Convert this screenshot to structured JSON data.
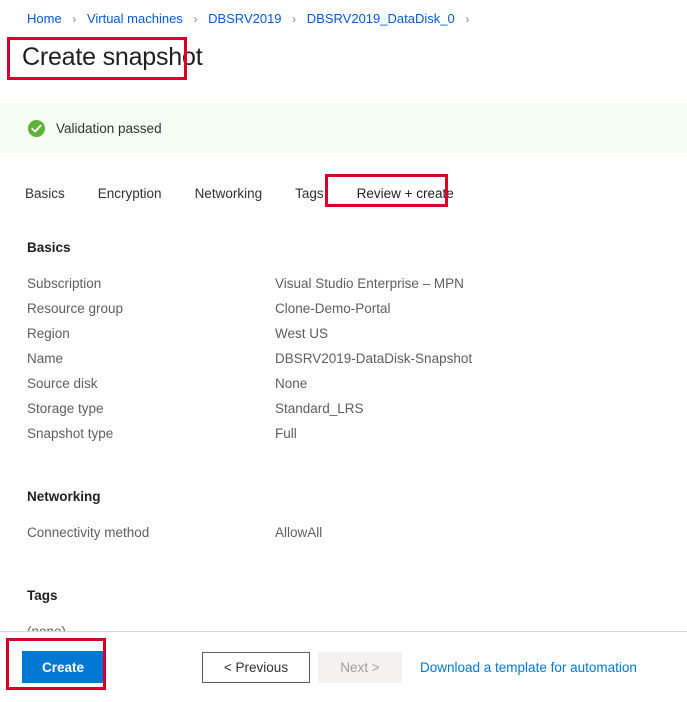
{
  "breadcrumb": {
    "separator": "›",
    "items": [
      {
        "label": "Home"
      },
      {
        "label": "Virtual machines"
      },
      {
        "label": "DBSRV2019"
      },
      {
        "label": "DBSRV2019_DataDisk_0"
      }
    ]
  },
  "header": {
    "title": "Create snapshot"
  },
  "validation": {
    "text": "Validation passed",
    "icon": "check-circle-icon",
    "background_color": "#f6fdf2",
    "icon_color": "#5cb335"
  },
  "tabs": [
    {
      "label": "Basics",
      "active": false
    },
    {
      "label": "Encryption",
      "active": false
    },
    {
      "label": "Networking",
      "active": false
    },
    {
      "label": "Tags",
      "active": false
    },
    {
      "label": "Review + create",
      "active": true
    }
  ],
  "sections": {
    "basics": {
      "title": "Basics",
      "rows": [
        {
          "label": "Subscription",
          "value": "Visual Studio Enterprise – MPN"
        },
        {
          "label": "Resource group",
          "value": "Clone-Demo-Portal"
        },
        {
          "label": "Region",
          "value": "West US"
        },
        {
          "label": "Name",
          "value": "DBSRV2019-DataDisk-Snapshot"
        },
        {
          "label": "Source disk",
          "value": "None"
        },
        {
          "label": "Storage type",
          "value": "Standard_LRS"
        },
        {
          "label": "Snapshot type",
          "value": "Full"
        }
      ]
    },
    "networking": {
      "title": "Networking",
      "rows": [
        {
          "label": "Connectivity method",
          "value": "AllowAll"
        }
      ]
    },
    "tags": {
      "title": "Tags",
      "empty_value": "(none)"
    }
  },
  "footer": {
    "create_label": "Create",
    "previous_label": "< Previous",
    "next_label": "Next >",
    "template_link_label": "Download a template for automation"
  },
  "highlights": {
    "color": "#d6002a",
    "targets": [
      "page-title",
      "tab-review-create",
      "create-button"
    ]
  }
}
